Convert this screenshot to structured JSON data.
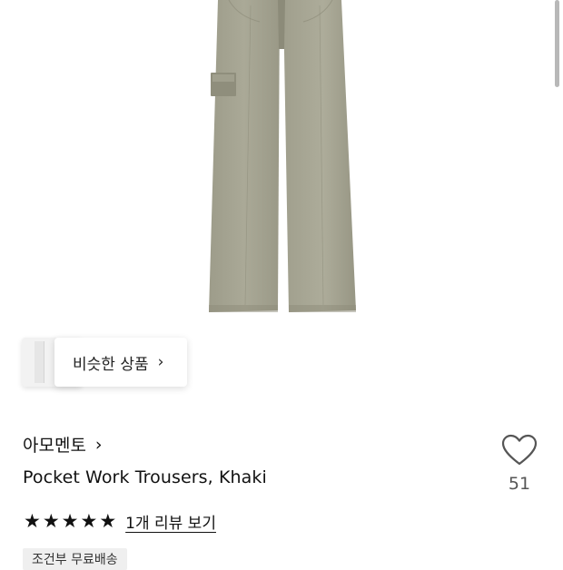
{
  "similar_products": {
    "label": "비슷한 상품"
  },
  "product": {
    "brand": "아모멘토",
    "name": "Pocket Work Trousers, Khaki",
    "likes": "51",
    "rating_stars": 5,
    "review_link": "1개 리뷰 보기",
    "shipping_badge": "조건부 무료배송"
  },
  "colors": {
    "pant_fill": "#a4a391",
    "pant_shadow": "#8f8e7c",
    "text": "#111111"
  }
}
